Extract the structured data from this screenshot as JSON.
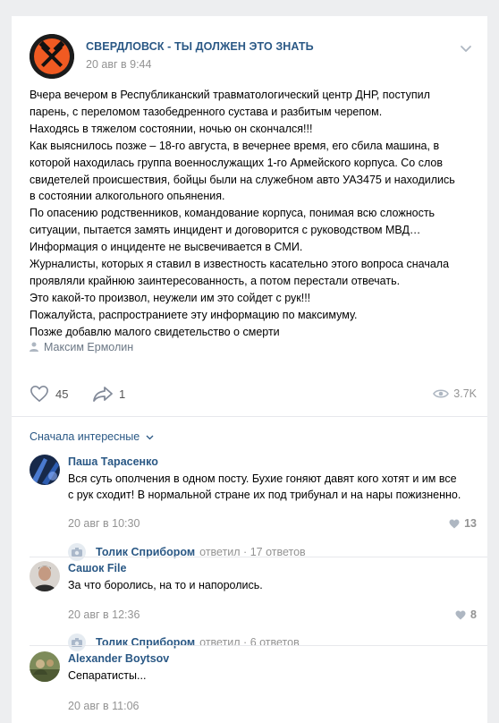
{
  "post": {
    "group_name": "СВЕРДЛОВСК - ТЫ ДОЛЖЕН ЭТО ЗНАТЬ",
    "date": "20 авг в 9:44",
    "lines": [
      "Вчера вечером в Республиканский травматологический центр ДНР, поступил",
      "парень, с переломом тазобедренного сустава и разбитым черепом.",
      "Находясь в тяжелом состоянии, ночью он скончался!!!",
      "Как выяснилось позже – 18-го августа, в вечернее время, его сбила машина, в",
      "которой находилась группа военнослужащих 1-го Армейского корпуса. Со слов",
      "свидетелей происшествия, бойцы были на служебном авто УАЗ475 и находились",
      "в состоянии алкогольного опьянения.",
      "По опасению родственников, командование корпуса, понимая всю сложность",
      "ситуации, пытается замять инцидент и договорится с руководством МВД…",
      "Информация о инциденте не высвечивается в СМИ.",
      "Журналисты, которых я ставил в известность касательно этого вопроса сначала",
      "проявляли крайнюю заинтересованность, а потом перестали отвечать.",
      "Это какой-то произвол, неужели им это сойдет с рук!!!",
      "Пожалуйста, распространиете эту информацию по максимуму.",
      "Позже добавлю малого свидетельство о смерти"
    ],
    "author": "Максим Ермолин",
    "likes": "45",
    "shares": "1",
    "views": "3.7K"
  },
  "comments_sort": "Сначала интересные",
  "comments": [
    {
      "name": "Паша Тарасенко",
      "lines": [
        "Вся суть ополчения в одном посту. Бухие гоняют давят кого хотят и им все",
        "с рук сходит! В нормальной стране их под трибунал и на нары пожизненно."
      ],
      "date": "20 авг в 10:30",
      "likes": "13",
      "reply": {
        "name": "Толик Сприбором",
        "text": "ответил · 17 ответов"
      }
    },
    {
      "name": "Сашок File",
      "lines": [
        "За что боролись, на то и напоролись."
      ],
      "date": "20 авг в 12:36",
      "likes": "8",
      "reply": {
        "name": "Толик Сприбором",
        "text": "ответил · 6 ответов"
      }
    },
    {
      "name": "Alexander Boytsov",
      "lines": [
        "Сепаратисты..."
      ],
      "date": "20 авг в 11:06"
    }
  ],
  "colors": {
    "link": "#2a5885",
    "muted": "#939393",
    "background": "#edeef0"
  },
  "icons": [
    "chevron-down-icon",
    "person-icon",
    "heart-icon",
    "share-icon",
    "eye-icon",
    "camera-icon"
  ]
}
